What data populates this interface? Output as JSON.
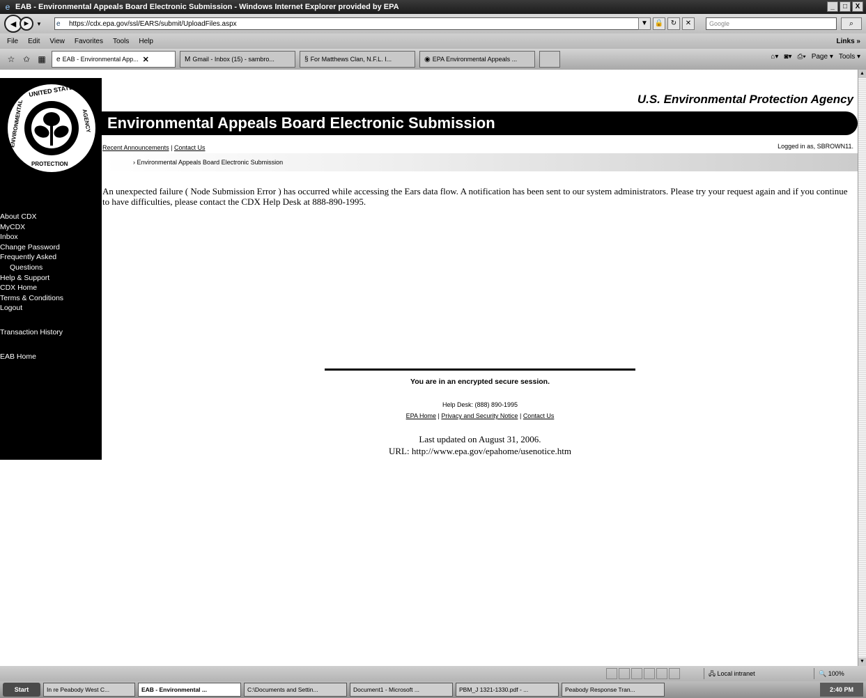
{
  "window": {
    "title": "EAB - Environmental Appeals Board Electronic Submission - Windows Internet Explorer provided by EPA",
    "min": "_",
    "max": "□",
    "close": "X"
  },
  "address": {
    "url": "https://cdx.epa.gov/ssl/EARS/submit/UploadFiles.aspx",
    "search_placeholder": "Google"
  },
  "menu": {
    "items": [
      "File",
      "Edit",
      "View",
      "Favorites",
      "Tools",
      "Help"
    ],
    "links": "Links »"
  },
  "tabs": [
    {
      "label": "EAB - Environmental App...",
      "active": true
    },
    {
      "label": "Gmail - Inbox (15) - sambro...",
      "active": false
    },
    {
      "label": "For Matthews Clan, N.F.L. I...",
      "active": false
    },
    {
      "label": "EPA Environmental Appeals ...",
      "active": false
    },
    {
      "label": "",
      "active": false
    }
  ],
  "commands": {
    "page": "Page ▾",
    "tools": "Tools ▾"
  },
  "page": {
    "agency": "U.S. Environmental Protection Agency",
    "banner": "Environmental Appeals Board Electronic Submission",
    "top_links": {
      "announcements": "Recent Announcements",
      "separator": "|",
      "contact": "Contact Us"
    },
    "logged_in": "Logged in as, SBROWN11.",
    "breadcrumb": "› Environmental Appeals Board Electronic Submission",
    "error": "An unexpected failure ( Node Submission Error ) has occurred while accessing the Ears data flow. A notification has been sent to our system administrators. Please try your request again and if you continue to have difficulties, please contact the CDX Help Desk at 888-890-1995.",
    "seal": {
      "top": "UNITED STATES",
      "left": "ENVIRONMENTAL",
      "right": "AGENCY",
      "bottom": "PROTECTION"
    }
  },
  "nav": {
    "items": [
      "About CDX",
      "MyCDX",
      "Inbox",
      "Change Password",
      "Frequently Asked",
      "Questions",
      "Help & Support",
      "CDX Home",
      "Terms & Conditions",
      "Logout"
    ],
    "transaction_history": "Transaction History",
    "eab_home": "EAB Home"
  },
  "footer": {
    "secure": "You are in an encrypted secure session.",
    "helpdesk": "Help Desk: (888) 890-1995",
    "link_home": "EPA Home",
    "sep": "|",
    "link_privacy": "Privacy and Security Notice",
    "link_contact": "Contact Us",
    "updated": "Last updated on August 31, 2006.",
    "url": "URL: http://www.epa.gov/epahome/usenotice.htm"
  },
  "status": {
    "zone": "Local intranet",
    "zoom": "100%"
  },
  "taskbar": {
    "start": "Start",
    "tasks": [
      {
        "label": "In re Peabody West C...",
        "active": false
      },
      {
        "label": "EAB - Environmental ...",
        "active": true
      },
      {
        "label": "C:\\Documents and Settin...",
        "active": false
      },
      {
        "label": "Document1 - Microsoft ...",
        "active": false
      },
      {
        "label": "PBM_J 1321-1330.pdf - ...",
        "active": false
      },
      {
        "label": "Peabody Response Tran...",
        "active": false
      }
    ],
    "clock": "2:40 PM"
  },
  "colors": {
    "nav_bg": "#000000",
    "banner_bg": "#000000",
    "banner_text": "#ffffff"
  }
}
